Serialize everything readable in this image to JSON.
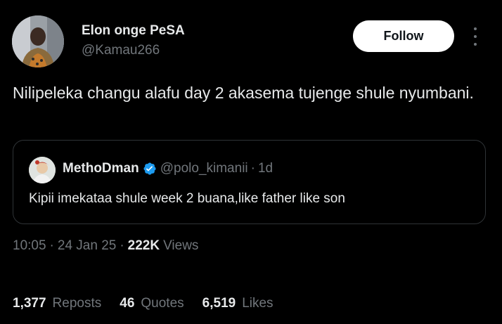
{
  "author": {
    "display_name": "Elon onge PeSA",
    "handle": "@Kamau266"
  },
  "follow_button": "Follow",
  "tweet_text": "Nilipeleka changu alafu day 2 akasema tujenge shule nyumbani.",
  "quote": {
    "name": "MethoDman",
    "handle": "@polo_kimanii",
    "dot": "·",
    "time": "1d",
    "text": "Kipii imekataa shule week 2 buana,like father like son"
  },
  "meta": {
    "time": "10:05",
    "sep1": "·",
    "date": "24 Jan 25",
    "sep2": "·",
    "views_count": "222K",
    "views_label": "Views"
  },
  "stats": {
    "reposts_count": "1,377",
    "reposts_label": "Reposts",
    "quotes_count": "46",
    "quotes_label": "Quotes",
    "likes_count": "6,519",
    "likes_label": "Likes"
  },
  "icons": {
    "more": "more-vertical-icon",
    "verified": "verified-badge-icon"
  },
  "colors": {
    "background": "#000000",
    "text_primary": "#e7e9ea",
    "text_secondary": "#71767b",
    "follow_bg": "#ffffff",
    "verified": "#1d9bf0",
    "border": "#2f3336"
  }
}
